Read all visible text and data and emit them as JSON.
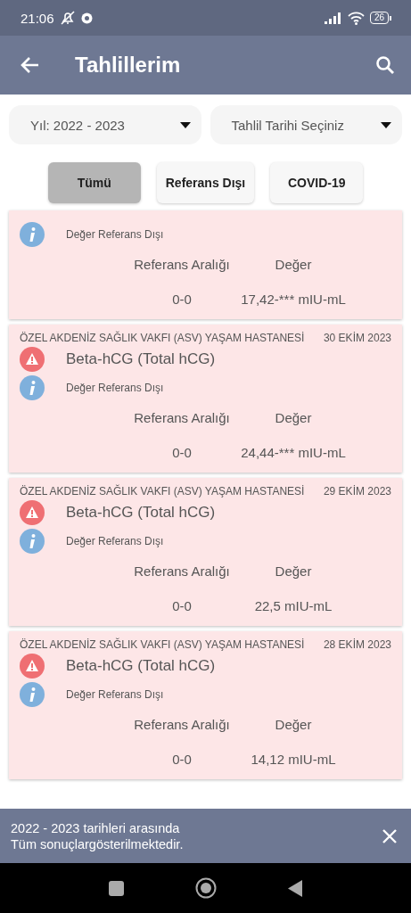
{
  "status_bar": {
    "time": "21:06",
    "battery": "26"
  },
  "app_bar": {
    "title": "Tahlillerim"
  },
  "dropdowns": [
    {
      "value": "Yıl: 2022 - 2023"
    },
    {
      "value": "Tahlil Tarihi Seçiniz"
    }
  ],
  "filters": [
    {
      "label": "Tümü",
      "selected": true
    },
    {
      "label": "Referans Dışı",
      "selected": false
    },
    {
      "label": "COVID-19",
      "selected": false
    }
  ],
  "results": [
    {
      "note": "Değer Referans Dışı",
      "range_label": "Referans Aralığı",
      "value_label": "Değer",
      "range": "0-0",
      "value": "17,42-*** mIU-mL"
    },
    {
      "hospital": "ÖZEL AKDENİZ SAĞLIK VAKFI (ASV) YAŞAM HASTANESİ",
      "date": "30 EKİM 2023",
      "test": "Beta-hCG (Total hCG)",
      "note": "Değer Referans Dışı",
      "range_label": "Referans Aralığı",
      "value_label": "Değer",
      "range": "0-0",
      "value": "24,44-*** mIU-mL"
    },
    {
      "hospital": "ÖZEL AKDENİZ SAĞLIK VAKFI (ASV) YAŞAM HASTANESİ",
      "date": "29 EKİM 2023",
      "test": "Beta-hCG (Total hCG)",
      "note": "Değer Referans Dışı",
      "range_label": "Referans Aralığı",
      "value_label": "Değer",
      "range": "0-0",
      "value": "22,5 mIU-mL"
    },
    {
      "hospital": "ÖZEL AKDENİZ SAĞLIK VAKFI (ASV) YAŞAM HASTANESİ",
      "date": "28 EKİM 2023",
      "test": "Beta-hCG (Total hCG)",
      "note": "Değer Referans Dışı",
      "range_label": "Referans Aralığı",
      "value_label": "Değer",
      "range": "0-0",
      "value": "14,12 mIU-mL"
    }
  ],
  "snackbar": {
    "message": "2022 - 2023 tarihleri arasında Tüm sonuçlargösterilmektedir."
  }
}
